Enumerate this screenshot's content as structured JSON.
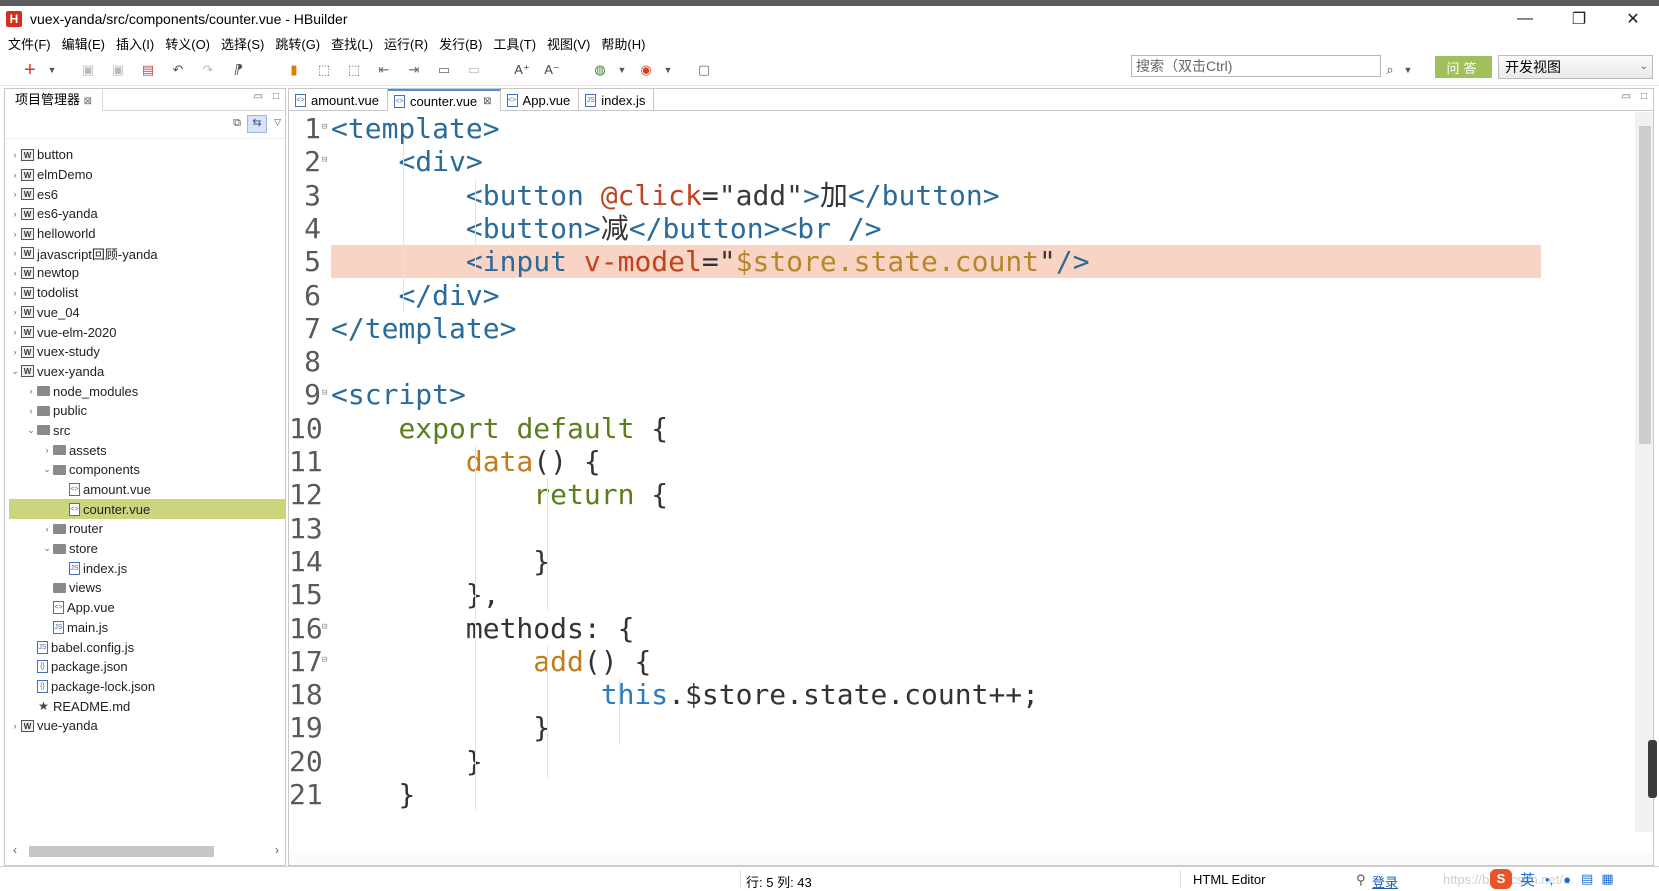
{
  "window": {
    "app_logo": "H",
    "title": "vuex-yanda/src/components/counter.vue  -  HBuilder",
    "minimize": "—",
    "restore": "❐",
    "close": "✕"
  },
  "menu": [
    "文件(F)",
    "编辑(E)",
    "插入(I)",
    "转义(O)",
    "选择(S)",
    "跳转(G)",
    "查找(L)",
    "运行(R)",
    "发行(B)",
    "工具(T)",
    "视图(V)",
    "帮助(H)"
  ],
  "toolbar": {
    "search_placeholder": "搜索（双击Ctrl)",
    "ask_button": "问答",
    "view_select": "开发视图"
  },
  "project_panel": {
    "tab_label": "项目管理器",
    "tab_close": "⊠",
    "tree": [
      {
        "label": "button",
        "depth": 0,
        "twisty": "›",
        "icon": "project-icon"
      },
      {
        "label": "elmDemo",
        "depth": 0,
        "twisty": "›",
        "icon": "project-icon"
      },
      {
        "label": "es6",
        "depth": 0,
        "twisty": "›",
        "icon": "project-icon"
      },
      {
        "label": "es6-yanda",
        "depth": 0,
        "twisty": "›",
        "icon": "project-icon"
      },
      {
        "label": "helloworld",
        "depth": 0,
        "twisty": "›",
        "icon": "project-icon"
      },
      {
        "label": "javascript回顾-yanda",
        "depth": 0,
        "twisty": "›",
        "icon": "project-icon"
      },
      {
        "label": "newtop",
        "depth": 0,
        "twisty": "›",
        "icon": "project-icon"
      },
      {
        "label": "todolist",
        "depth": 0,
        "twisty": "›",
        "icon": "project-icon"
      },
      {
        "label": "vue_04",
        "depth": 0,
        "twisty": "›",
        "icon": "project-icon"
      },
      {
        "label": "vue-elm-2020",
        "depth": 0,
        "twisty": "›",
        "icon": "project-icon"
      },
      {
        "label": "vuex-study",
        "depth": 0,
        "twisty": "›",
        "icon": "project-icon"
      },
      {
        "label": "vuex-yanda",
        "depth": 0,
        "twisty": "⌄",
        "icon": "project-icon"
      },
      {
        "label": "node_modules",
        "depth": 1,
        "twisty": "›",
        "icon": "folder-icon"
      },
      {
        "label": "public",
        "depth": 1,
        "twisty": "›",
        "icon": "folder-icon"
      },
      {
        "label": "src",
        "depth": 1,
        "twisty": "⌄",
        "icon": "folder-icon"
      },
      {
        "label": "assets",
        "depth": 2,
        "twisty": "›",
        "icon": "folder-icon"
      },
      {
        "label": "components",
        "depth": 2,
        "twisty": "⌄",
        "icon": "folder-icon"
      },
      {
        "label": "amount.vue",
        "depth": 3,
        "twisty": "",
        "icon": "vue-file-icon"
      },
      {
        "label": "counter.vue",
        "depth": 3,
        "twisty": "",
        "icon": "vue-file-icon",
        "selected": true
      },
      {
        "label": "router",
        "depth": 2,
        "twisty": "›",
        "icon": "folder-icon"
      },
      {
        "label": "store",
        "depth": 2,
        "twisty": "⌄",
        "icon": "folder-icon"
      },
      {
        "label": "index.js",
        "depth": 3,
        "twisty": "",
        "icon": "js-file-icon"
      },
      {
        "label": "views",
        "depth": 2,
        "twisty": "",
        "icon": "folder-icon"
      },
      {
        "label": "App.vue",
        "depth": 2,
        "twisty": "",
        "icon": "vue-file-icon"
      },
      {
        "label": "main.js",
        "depth": 2,
        "twisty": "",
        "icon": "js-file-icon"
      },
      {
        "label": "babel.config.js",
        "depth": 1,
        "twisty": "",
        "icon": "js-file-icon"
      },
      {
        "label": "package.json",
        "depth": 1,
        "twisty": "",
        "icon": "json-file-icon"
      },
      {
        "label": "package-lock.json",
        "depth": 1,
        "twisty": "",
        "icon": "json-file-icon"
      },
      {
        "label": "README.md",
        "depth": 1,
        "twisty": "",
        "icon": "star-icon"
      },
      {
        "label": "vue-yanda",
        "depth": 0,
        "twisty": "›",
        "icon": "project-icon"
      }
    ]
  },
  "editor": {
    "tabs": [
      {
        "label": "amount.vue",
        "active": false,
        "closable": false
      },
      {
        "label": "counter.vue",
        "active": true,
        "closable": true
      },
      {
        "label": "App.vue",
        "active": false,
        "closable": false
      },
      {
        "label": "index.js",
        "active": false,
        "closable": false
      }
    ],
    "highlighted_line": 5,
    "lines": [
      {
        "n": "1",
        "fold": "⊟",
        "tokens": [
          [
            "tag",
            "<template>"
          ]
        ]
      },
      {
        "n": "2",
        "fold": "⊟",
        "tokens": [
          [
            "def",
            "    "
          ],
          [
            "tag",
            "<div>"
          ]
        ]
      },
      {
        "n": "3",
        "fold": "",
        "tokens": [
          [
            "def",
            "        "
          ],
          [
            "tag",
            "<button "
          ],
          [
            "attr",
            "@click"
          ],
          [
            "def",
            "="
          ],
          [
            "str",
            "\"add\""
          ],
          [
            "tag",
            ">"
          ],
          [
            "def",
            "加"
          ],
          [
            "tag",
            "</button>"
          ]
        ]
      },
      {
        "n": "4",
        "fold": "",
        "tokens": [
          [
            "def",
            "        "
          ],
          [
            "tag",
            "<button>"
          ],
          [
            "def",
            "减"
          ],
          [
            "tag",
            "</button><br />"
          ]
        ]
      },
      {
        "n": "5",
        "fold": "",
        "tokens": [
          [
            "def",
            "        "
          ],
          [
            "tag",
            "<input "
          ],
          [
            "attr",
            "v-model"
          ],
          [
            "def",
            "="
          ],
          [
            "str",
            "\""
          ],
          [
            "sv",
            "$store.state.count"
          ],
          [
            "str",
            "\""
          ],
          [
            "tag",
            "/>"
          ]
        ]
      },
      {
        "n": "6",
        "fold": "",
        "tokens": [
          [
            "def",
            "    "
          ],
          [
            "tag",
            "</div>"
          ]
        ]
      },
      {
        "n": "7",
        "fold": "",
        "tokens": [
          [
            "tag",
            "</template>"
          ]
        ]
      },
      {
        "n": "8",
        "fold": "",
        "tokens": []
      },
      {
        "n": "9",
        "fold": "⊟",
        "tokens": [
          [
            "tag",
            "<script>"
          ]
        ]
      },
      {
        "n": "10",
        "fold": "",
        "tokens": [
          [
            "def",
            "    "
          ],
          [
            "kw",
            "export default"
          ],
          [
            "def",
            " {"
          ]
        ]
      },
      {
        "n": "11",
        "fold": "",
        "tokens": [
          [
            "def",
            "        "
          ],
          [
            "fn",
            "data"
          ],
          [
            "def",
            "() {"
          ]
        ]
      },
      {
        "n": "12",
        "fold": "",
        "tokens": [
          [
            "def",
            "            "
          ],
          [
            "kw",
            "return"
          ],
          [
            "def",
            " {"
          ]
        ]
      },
      {
        "n": "13",
        "fold": "",
        "tokens": []
      },
      {
        "n": "14",
        "fold": "",
        "tokens": [
          [
            "def",
            "            }"
          ]
        ]
      },
      {
        "n": "15",
        "fold": "",
        "tokens": [
          [
            "def",
            "        },"
          ]
        ]
      },
      {
        "n": "16",
        "fold": "⊟",
        "tokens": [
          [
            "def",
            "        methods: {"
          ]
        ]
      },
      {
        "n": "17",
        "fold": "⊟",
        "tokens": [
          [
            "def",
            "            "
          ],
          [
            "fn",
            "add"
          ],
          [
            "def",
            "() {"
          ]
        ]
      },
      {
        "n": "18",
        "fold": "",
        "tokens": [
          [
            "def",
            "                "
          ],
          [
            "this",
            "this"
          ],
          [
            "def",
            ".$store.state.count++;"
          ]
        ]
      },
      {
        "n": "19",
        "fold": "",
        "tokens": [
          [
            "def",
            "            }"
          ]
        ]
      },
      {
        "n": "20",
        "fold": "",
        "tokens": [
          [
            "def",
            "        }"
          ]
        ]
      },
      {
        "n": "21",
        "fold": "",
        "tokens": [
          [
            "def",
            "    }"
          ]
        ]
      }
    ]
  },
  "status": {
    "cursor": "行: 5 列: 43",
    "editor_type": "HTML Editor",
    "login": "登录",
    "watermark": "https://blog.csdn.net/..."
  },
  "ime": {
    "logo": "S",
    "lang": "英",
    "punct": "•,",
    "mic": "🎤"
  }
}
